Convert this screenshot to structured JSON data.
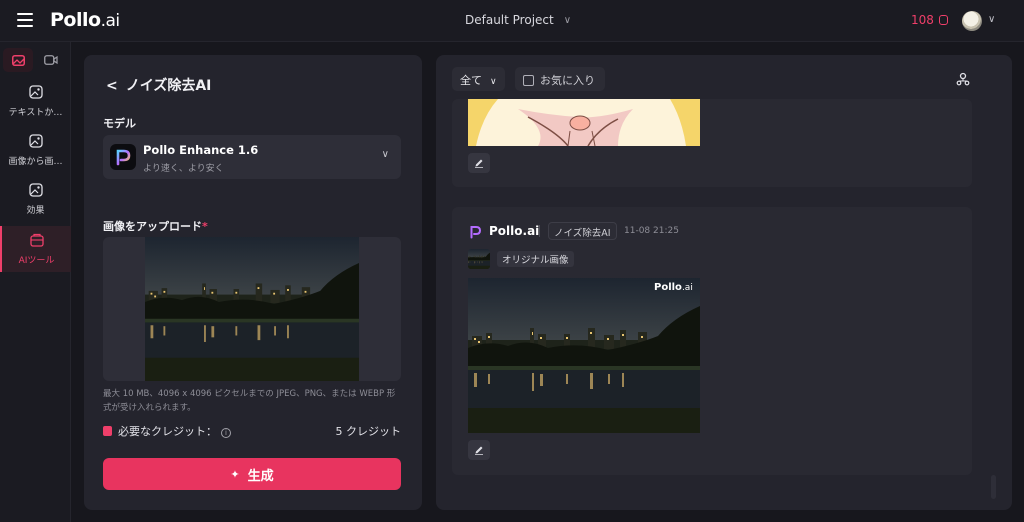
{
  "header": {
    "logo_main": "Pollo",
    "logo_suffix": ".ai",
    "project": "Default Project",
    "credits": "108"
  },
  "nav": {
    "items": [
      {
        "label": "テキストか…",
        "icon": "text-to-image-icon"
      },
      {
        "label": "画像から画…",
        "icon": "image-to-image-icon"
      },
      {
        "label": "効果",
        "icon": "effects-icon"
      },
      {
        "label": "AIツール",
        "icon": "ai-tools-icon"
      }
    ],
    "active_color": "#ef3f6a"
  },
  "tool": {
    "title": "ノイズ除去AI",
    "model_label": "モデル",
    "model_name": "Pollo Enhance 1.6",
    "model_sub": "より速く、より安く",
    "upload_label": "画像をアップロード",
    "upload_required": "*",
    "hint": "最大 10 MB、4096 x 4096 ピクセルまでの JPEG、PNG、または WEBP 形式が受け入れられます。",
    "credit_label": "必要なクレジット：",
    "credit_value": "5 クレジット",
    "generate_label": "生成"
  },
  "results": {
    "filter_label": "全て",
    "favorites_label": "お気に入り",
    "card": {
      "brand": "Pollo.ai",
      "tag": "ノイズ除去AI",
      "time": "11-08 21:25",
      "original_label": "オリジナル画像",
      "watermark_main": "Pollo",
      "watermark_suffix": ".ai"
    }
  },
  "colors": {
    "accent": "#e8345f",
    "background": "#17171d",
    "panel": "#24242d"
  }
}
